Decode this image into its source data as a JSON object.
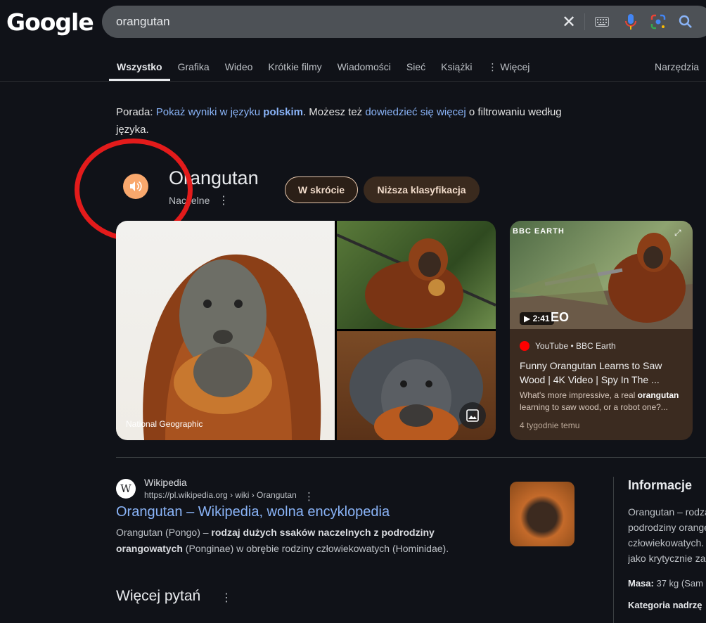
{
  "header": {
    "logo": "Google",
    "search": {
      "value": "orangutan"
    },
    "icons": [
      "close-icon",
      "keyboard-icon",
      "mic-icon",
      "lens-icon",
      "search-icon"
    ]
  },
  "tabs": {
    "items": [
      "Wszystko",
      "Grafika",
      "Wideo",
      "Krótkie filmy",
      "Wiadomości",
      "Sieć",
      "Książki",
      "⋮ Więcej"
    ],
    "active": "Wszystko",
    "tools": "Narzędzia"
  },
  "tip": {
    "prefix": "Porada: ",
    "link1": "Pokaż wyniki w języku ",
    "link1_bold": "polskim",
    "middle": ". Możesz też ",
    "link2": "dowiedzieć się więcej",
    "suffix": " o filtrowaniu według języka."
  },
  "entity": {
    "title": "Orangutan",
    "subtitle": "Naczelne",
    "chips": [
      "W skrócie",
      "Niższa klasyfikacja"
    ]
  },
  "images": {
    "main_source": "National Geographic"
  },
  "video": {
    "channel_logo": "BBC EARTH",
    "duration": "2:41",
    "overlay_text": "EO",
    "source": "YouTube • BBC Earth",
    "title": "Funny Orangutan Learns to Saw Wood | 4K Video | Spy In The ...",
    "snippet_prefix": "What's more impressive, a real ",
    "snippet_bold": "orangutan",
    "snippet_suffix": " learning to saw wood, or a robot one?...",
    "time": "4 tygodnie temu"
  },
  "wiki": {
    "icon_letter": "W",
    "name": "Wikipedia",
    "url": "https://pl.wikipedia.org › wiki › Orangutan",
    "title": "Orangutan – Wikipedia, wolna encyklopedia",
    "snippet_a": "Orangutan (Pongo) – ",
    "snippet_b": "rodzaj dużych ssaków naczelnych z podrodziny orangowatych",
    "snippet_c": " (Ponginae) w obrębie rodziny człowiekowatych (Hominidae)."
  },
  "more_questions": "Więcej pytań",
  "info": {
    "title": "Informacje",
    "lines": [
      "Orangutan – rodza",
      "podrodziny orange",
      "człowiekowatych.",
      "jako krytycznie za"
    ],
    "mass_label": "Masa:",
    "mass_value": " 37 kg (Sam",
    "category_label": "Kategoria nadrzę"
  },
  "colors": {
    "background": "#101218",
    "link": "#8ab4f8",
    "speaker": "#f9a86d",
    "annotation": "#e31b1b"
  }
}
